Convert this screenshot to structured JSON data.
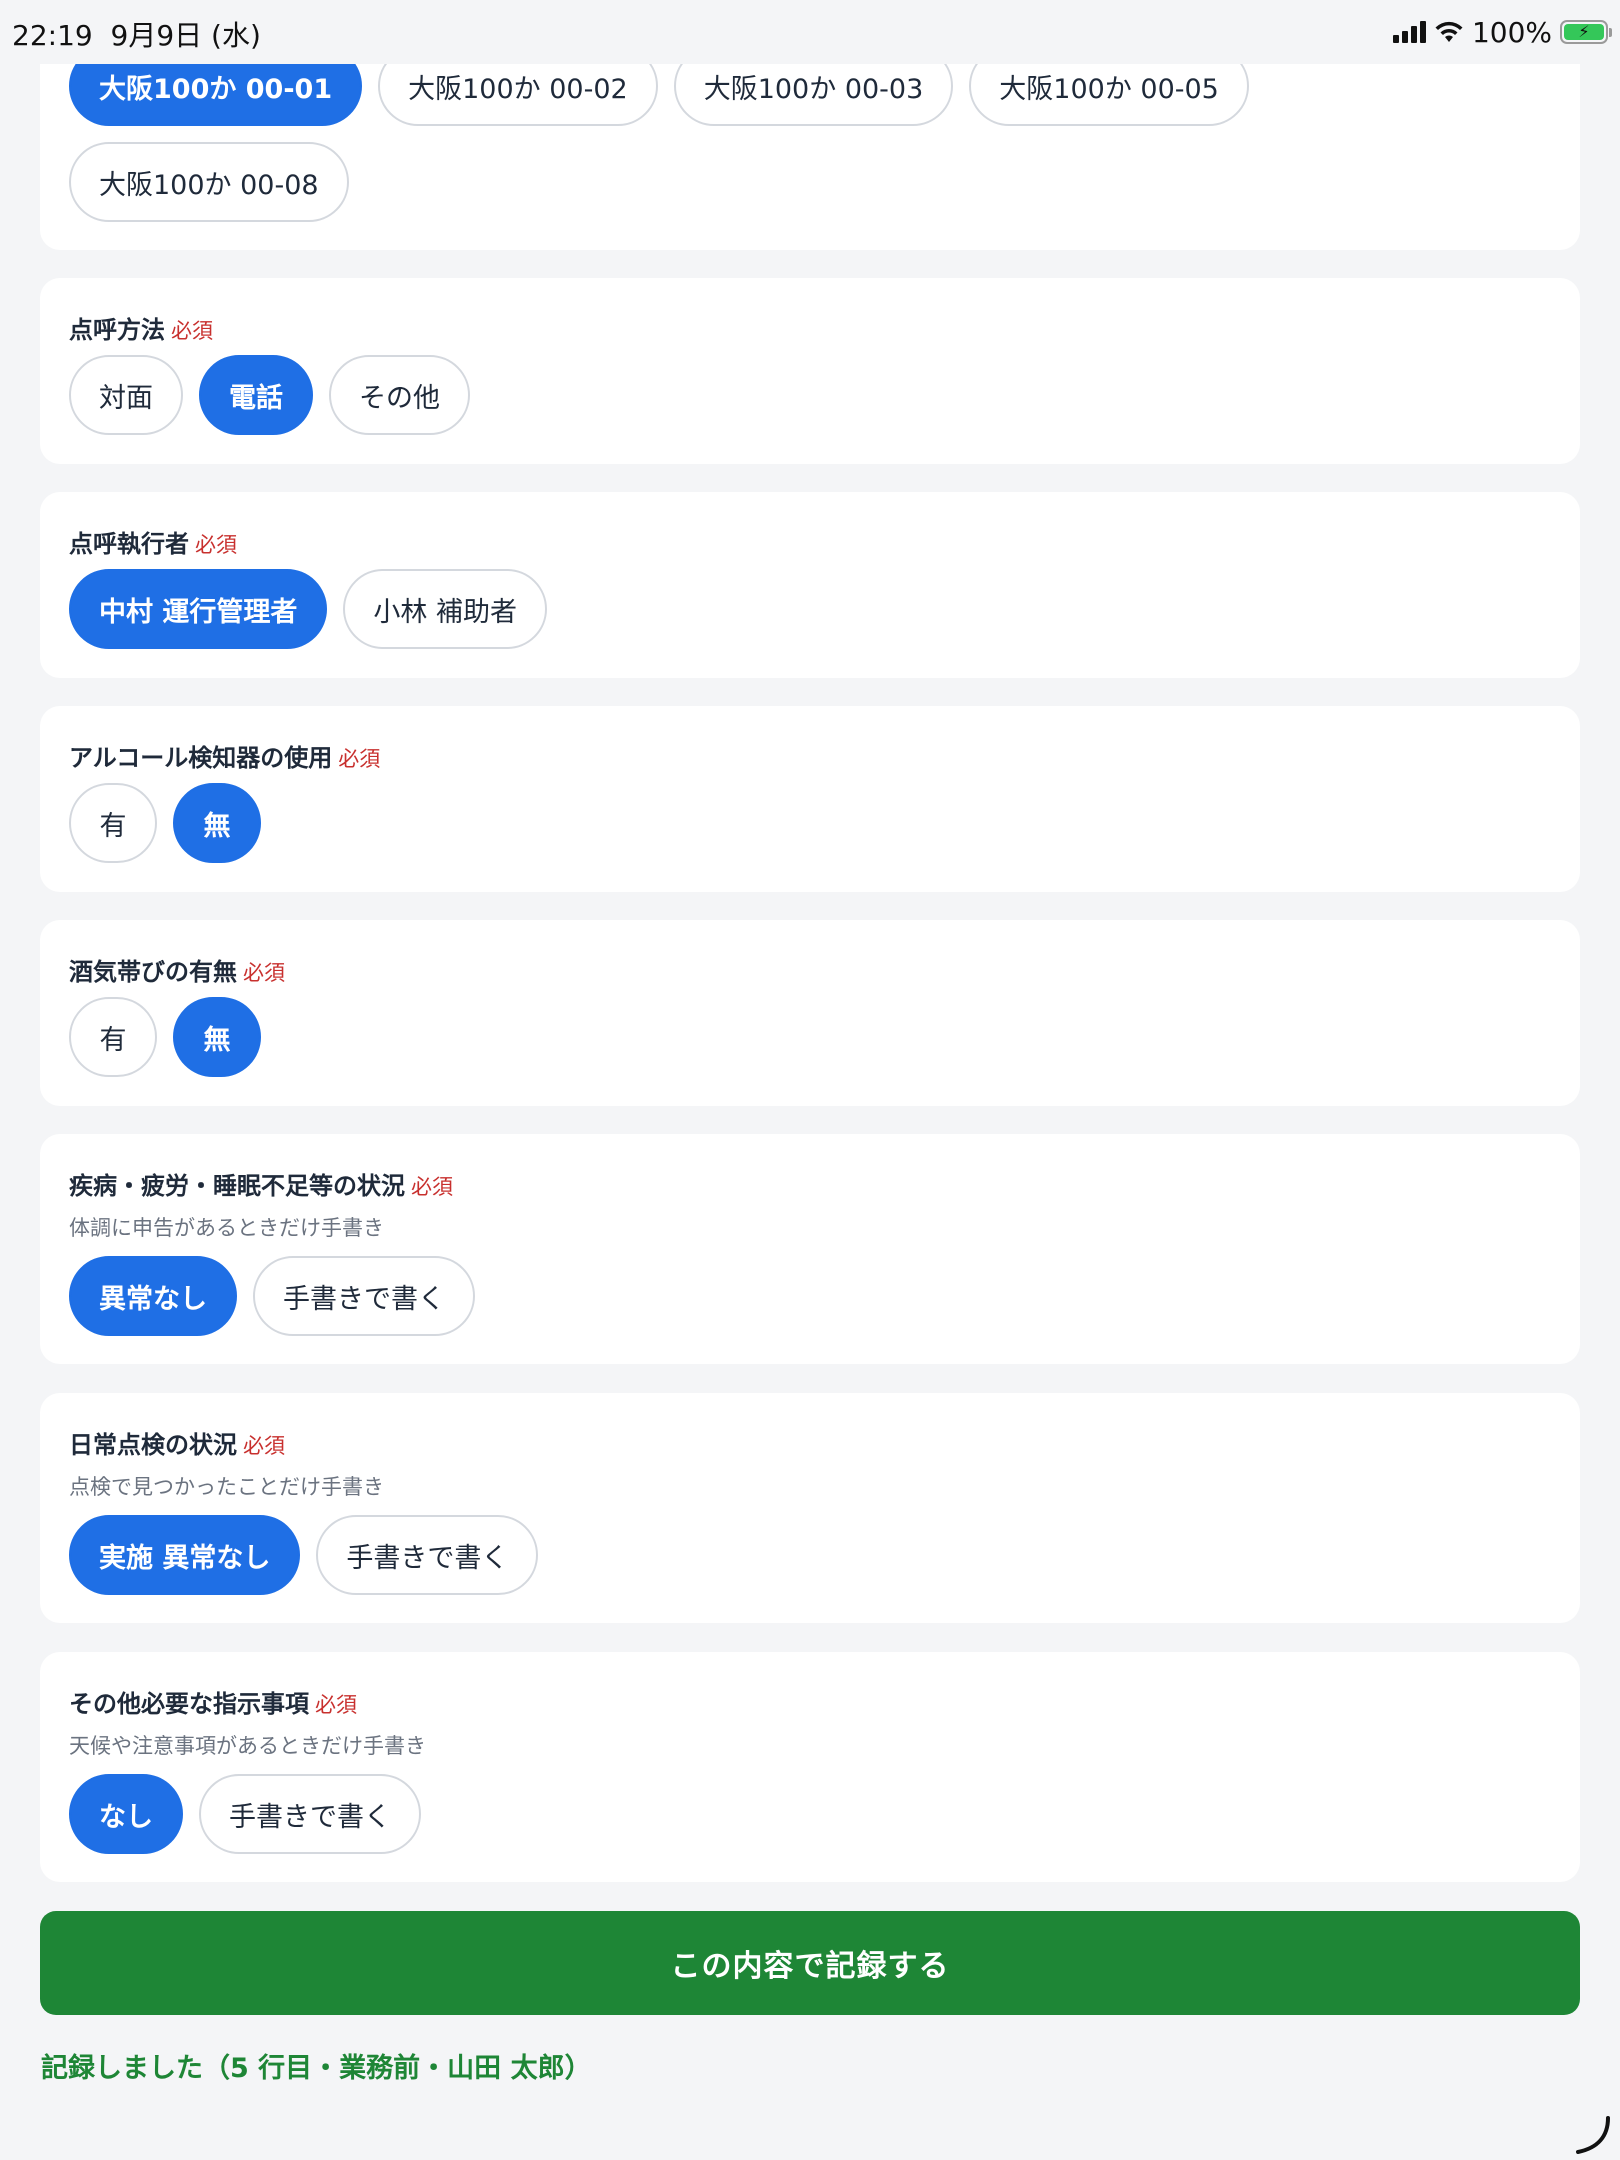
{
  "status_bar": {
    "time": "22:19",
    "date": "9月9日 (水)",
    "battery": "100%",
    "battery_fill": 1.0
  },
  "vehicles": {
    "options": [
      "大阪100か 00-01",
      "大阪100か 00-02",
      "大阪100か 00-03",
      "大阪100か 00-05",
      "大阪100か 00-08"
    ],
    "selected": 0
  },
  "method": {
    "title": "点呼方法",
    "required": "必須",
    "options": [
      "対面",
      "電話",
      "その他"
    ],
    "selected": 1
  },
  "executor": {
    "title": "点呼執行者",
    "required": "必須",
    "options": [
      "中村 運行管理者",
      "小林 補助者"
    ],
    "selected": 0
  },
  "alcohol_detector": {
    "title": "アルコール検知器の使用",
    "required": "必須",
    "options": [
      "有",
      "無"
    ],
    "selected": 1
  },
  "alcohol_presence": {
    "title": "酒気帯びの有無",
    "required": "必須",
    "options": [
      "有",
      "無"
    ],
    "selected": 1
  },
  "health": {
    "title": "疾病・疲労・睡眠不足等の状況",
    "required": "必須",
    "subtitle": "体調に申告があるときだけ手書き",
    "options": [
      "異常なし",
      "手書きで書く"
    ],
    "selected": 0
  },
  "daily_check": {
    "title": "日常点検の状況",
    "required": "必須",
    "subtitle": "点検で見つかったことだけ手書き",
    "options": [
      "実施 異常なし",
      "手書きで書く"
    ],
    "selected": 0
  },
  "instructions": {
    "title": "その他必要な指示事項",
    "required": "必須",
    "subtitle": "天候や注意事項があるときだけ手書き",
    "options": [
      "なし",
      "手書きで書く"
    ],
    "selected": 0
  },
  "record_button": "この内容で記録する",
  "result_message": "記録しました（5 行目・業務前・山田 太郎）",
  "colors": {
    "accent": "#1f6fe5",
    "submit": "#1e8636",
    "required": "#c8302e"
  }
}
